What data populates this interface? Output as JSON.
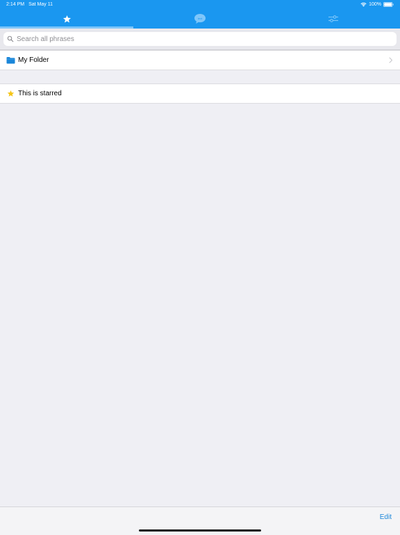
{
  "status_bar": {
    "time": "2:14 PM",
    "date": "Sat May 11",
    "battery": "100%",
    "wifi_icon": "wifi-icon",
    "battery_icon": "battery-icon"
  },
  "tabs": [
    {
      "icon": "star-icon",
      "active": true
    },
    {
      "icon": "text-bubble-icon",
      "label": "text",
      "active": false
    },
    {
      "icon": "sliders-icon",
      "active": false
    }
  ],
  "search": {
    "placeholder": "Search all phrases",
    "value": ""
  },
  "list": {
    "folder": {
      "label": "My Folder",
      "icon": "folder-icon"
    },
    "starred": {
      "label": "This is starred",
      "icon": "star-icon"
    }
  },
  "toolbar": {
    "edit_label": "Edit"
  },
  "colors": {
    "accent": "#1a97f0",
    "background": "#efeff4",
    "star": "#f5c518",
    "folder": "#1a86d9",
    "link": "#1a86d9"
  }
}
